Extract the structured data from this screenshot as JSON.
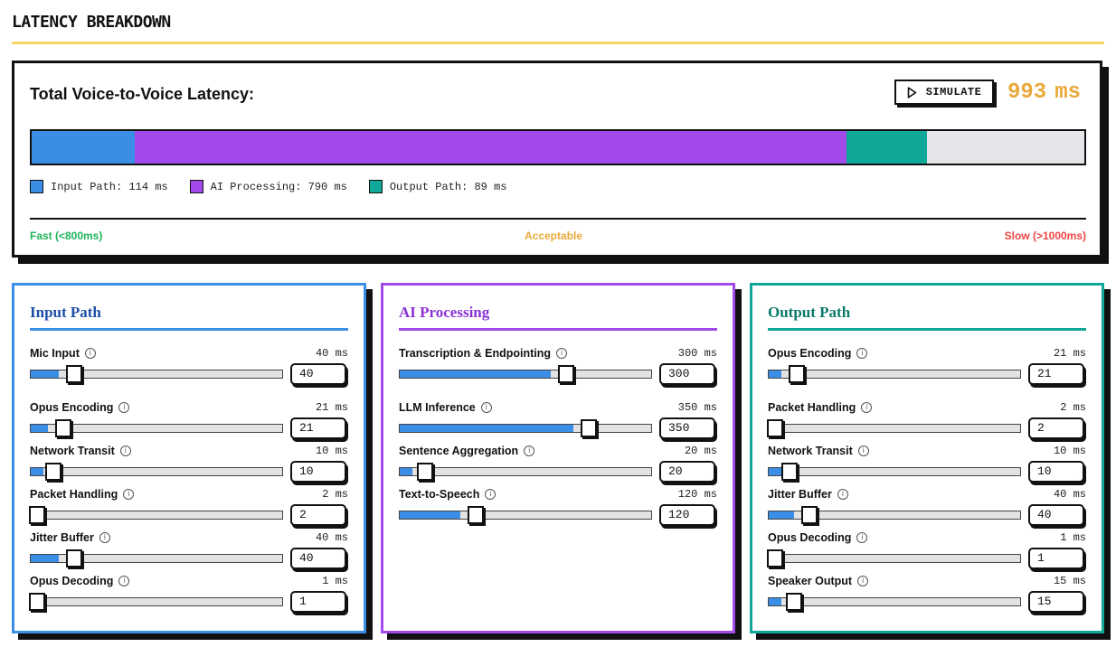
{
  "header": {
    "title": "LATENCY BREAKDOWN"
  },
  "summary": {
    "label": "Total Voice-to-Voice Latency:",
    "simulate_label": "SIMULATE",
    "simulate_icon": "play-icon",
    "total_value": "993",
    "total_unit": "ms",
    "total_color": "#e9a93a",
    "bar_max_ms": 1168,
    "segments": [
      {
        "name": "Input Path",
        "ms": 114,
        "color": "#3a8ee6",
        "legend": "Input Path: 114 ms"
      },
      {
        "name": "AI Processing",
        "ms": 790,
        "color": "#a14ae9",
        "legend": "AI Processing: 790 ms"
      },
      {
        "name": "Output Path",
        "ms": 89,
        "color": "#10a898",
        "legend": "Output Path: 89 ms"
      }
    ],
    "scale": {
      "fast": "Fast (<800ms)",
      "fast_color": "#1fb45a",
      "acceptable": "Acceptable",
      "acceptable_color": "#e9a93a",
      "slow": "Slow (>1000ms)",
      "slow_color": "#ef4444"
    }
  },
  "panels": [
    {
      "key": "input",
      "title": "Input Path",
      "border_color": "#3a8ee6",
      "title_color": "#1d4fa8",
      "rows": [
        {
          "label": "Mic Input",
          "value": "40",
          "ms": "40 ms",
          "fill": 0.11
        },
        {
          "label": "Opus Encoding",
          "value": "21",
          "ms": "21 ms",
          "fill": 0.07
        },
        {
          "label": "Network Transit",
          "value": "10",
          "ms": "10 ms",
          "fill": 0.03
        },
        {
          "label": "Packet Handling",
          "value": "2",
          "ms": "2 ms",
          "fill": 0.0
        },
        {
          "label": "Jitter Buffer",
          "value": "40",
          "ms": "40 ms",
          "fill": 0.11
        },
        {
          "label": "Opus Decoding",
          "value": "1",
          "ms": "1 ms",
          "fill": 0.0
        }
      ]
    },
    {
      "key": "ai",
      "title": "AI Processing",
      "border_color": "#a14ae9",
      "title_color": "#8a32d6",
      "rows": [
        {
          "label": "Transcription & Endpointing",
          "value": "300",
          "ms": "300 ms",
          "fill": 0.6
        },
        {
          "label": "LLM Inference",
          "value": "350",
          "ms": "350 ms",
          "fill": 0.69
        },
        {
          "label": "Sentence Aggregation",
          "value": "20",
          "ms": "20 ms",
          "fill": 0.04
        },
        {
          "label": "Text-to-Speech",
          "value": "120",
          "ms": "120 ms",
          "fill": 0.24
        }
      ]
    },
    {
      "key": "output",
      "title": "Output Path",
      "border_color": "#10a898",
      "title_color": "#0b7a6a",
      "rows": [
        {
          "label": "Opus Encoding",
          "value": "21",
          "ms": "21 ms",
          "fill": 0.05
        },
        {
          "label": "Packet Handling",
          "value": "2",
          "ms": "2 ms",
          "fill": 0.0
        },
        {
          "label": "Network Transit",
          "value": "10",
          "ms": "10 ms",
          "fill": 0.02
        },
        {
          "label": "Jitter Buffer",
          "value": "40",
          "ms": "40 ms",
          "fill": 0.1
        },
        {
          "label": "Opus Decoding",
          "value": "1",
          "ms": "1 ms",
          "fill": 0.0
        },
        {
          "label": "Speaker Output",
          "value": "15",
          "ms": "15 ms",
          "fill": 0.04
        }
      ]
    }
  ]
}
